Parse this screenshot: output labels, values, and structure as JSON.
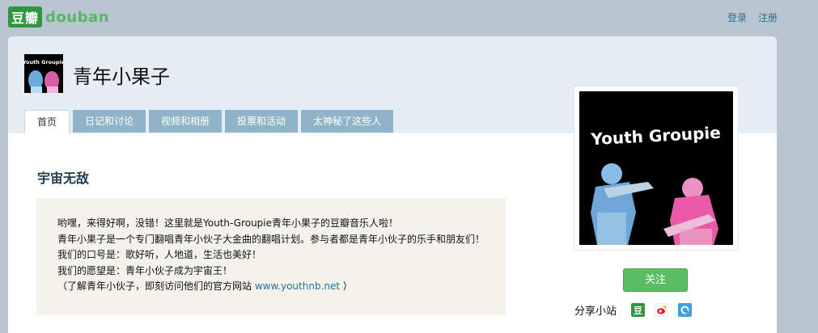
{
  "brand": {
    "logo_zh": "豆瓣",
    "logo_en": "douban"
  },
  "toplinks": {
    "login": "登录",
    "register": "注册"
  },
  "group": {
    "title": "青年小果子",
    "logo_text": "Youth Groupie"
  },
  "tabs": [
    {
      "label": "首页",
      "active": true
    },
    {
      "label": "日记和讨论"
    },
    {
      "label": "视频和相册"
    },
    {
      "label": "投票和活动"
    },
    {
      "label": "太神秘了这些人"
    }
  ],
  "section": {
    "title": "宇宙无敌"
  },
  "intro": {
    "line1": "哟嘿，来得好啊，没错！这里就是Youth-Groupie青年小果子的豆瓣音乐人啦！",
    "line2": "青年小果子是一个专门翻唱青年小伙子大金曲的翻唱计划。参与者都是青年小伙子的乐手和朋友们！",
    "line3": "我们的口号是：歌好听，人地道，生活也美好！",
    "line4": "我们的愿望是：青年小伙子成为宇宙王！",
    "line5_prefix": "（了解青年小伙子，即刻访问他们的官方网站 ",
    "link": "www.youthnb.net",
    "line5_suffix": " ）"
  },
  "actions": {
    "follow": "关注",
    "share_label": "分享小站"
  },
  "share_icons": [
    "douban-icon",
    "weibo-icon",
    "qzone-icon"
  ],
  "colors": {
    "background": "#b9c6cf",
    "tab": "#8fb4c8",
    "follow": "#5bbd61",
    "link": "#2a6f98"
  }
}
